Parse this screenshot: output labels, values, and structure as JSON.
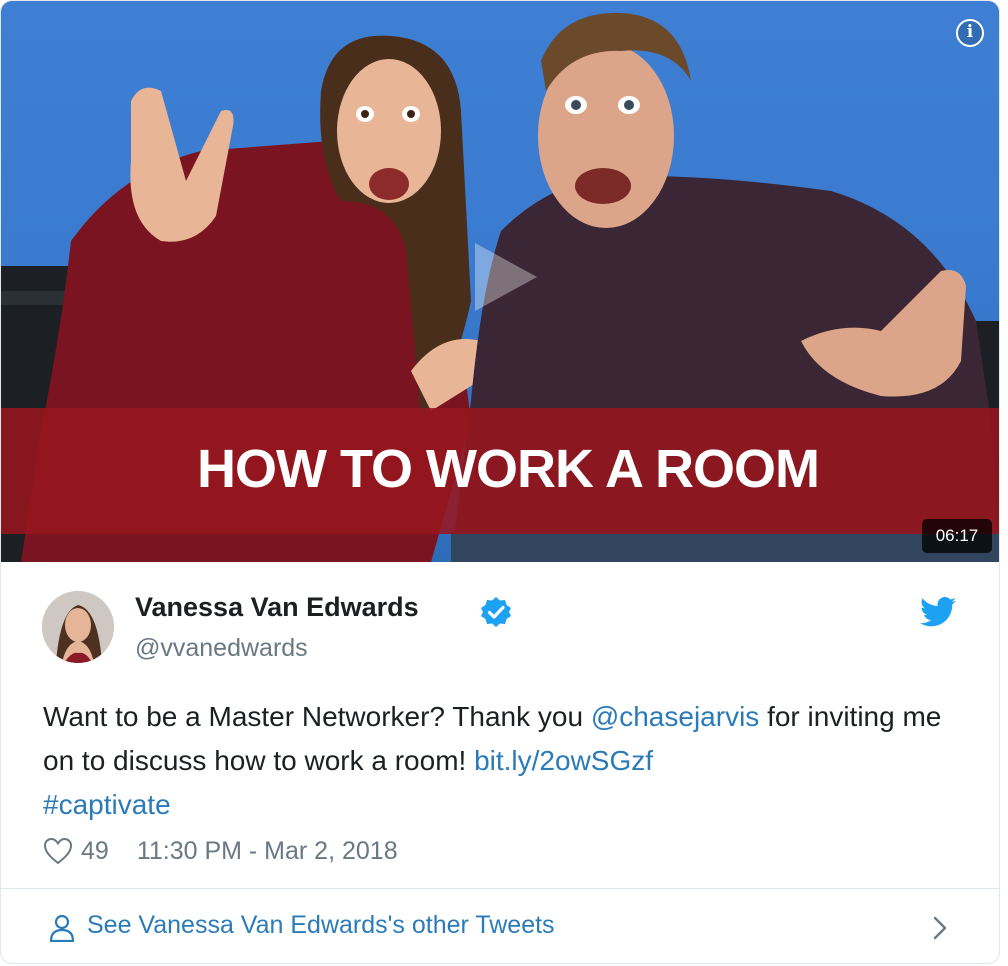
{
  "video": {
    "banner_text": "HOW TO WORK A ROOM",
    "duration": "06:17",
    "info_icon": "info-icon",
    "play_icon": "play-icon"
  },
  "tweet": {
    "author_name": "Vanessa Van Edwards",
    "author_handle": "@vvanedwards",
    "verified_icon": "verified-badge-icon",
    "platform_icon": "twitter-bird-icon",
    "text_parts": {
      "t1": "Want to be a Master Networker? Thank you ",
      "mention": "@chasejarvis",
      "t2": " for inviting me on to discuss how to work a room! ",
      "link": "bit.ly/2owSGzf",
      "t3": " ",
      "hashtag": "#captivate"
    },
    "like_count": "49",
    "timestamp": "11:30 PM - Mar 2, 2018"
  },
  "footer": {
    "link_label": "See Vanessa Van Edwards's other Tweets"
  },
  "colors": {
    "link": "#2b7bb9",
    "muted": "#697882",
    "text": "#1c2022",
    "banner": "#96161e",
    "video_bg": "#3e7fd3"
  }
}
